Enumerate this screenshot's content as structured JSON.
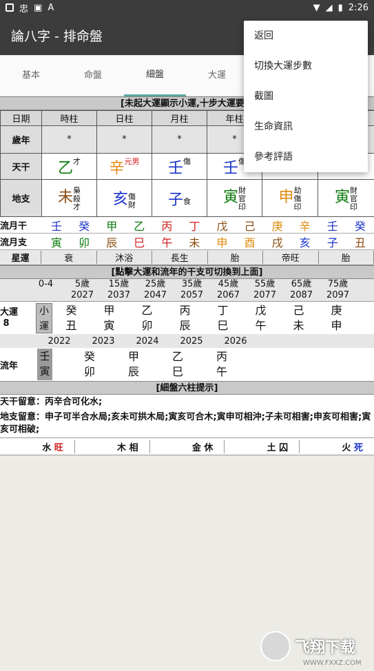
{
  "status": {
    "time": "2:26",
    "left_icons": [
      "square-icon",
      "app-icon",
      "image-icon",
      "a-icon"
    ]
  },
  "appbar": {
    "title": "論八字 - 排命盤"
  },
  "tabs": [
    {
      "label": "基本"
    },
    {
      "label": "命盤"
    },
    {
      "label": "細盤"
    },
    {
      "label": "大運"
    }
  ],
  "section1": {
    "title": "[未起大運顯示小運,十步大運要打"
  },
  "pillars": {
    "headers": [
      "日期",
      "時柱",
      "日柱",
      "月柱",
      "年柱"
    ],
    "sui_nian": {
      "label": "歲年",
      "values": [
        "*",
        "*",
        "*",
        "*"
      ]
    },
    "tiangan": {
      "label": "天干"
    },
    "dizhi": {
      "label": "地支"
    }
  },
  "tiangan": [
    {
      "char": "乙",
      "sup": "才"
    },
    {
      "char": "辛",
      "sup": "元男"
    },
    {
      "char": "壬",
      "sup": "傷"
    },
    {
      "char": "壬",
      "sup": "傷"
    }
  ],
  "dizhi": [
    {
      "char": "未",
      "notes": [
        "梟",
        "殺",
        "才"
      ]
    },
    {
      "char": "亥",
      "notes": [
        "傷",
        "財"
      ]
    },
    {
      "char": "子",
      "notes": [
        "食"
      ]
    },
    {
      "char": "寅",
      "notes": [
        "財",
        "官",
        "印"
      ]
    },
    {
      "char": "申",
      "notes": [
        "劫",
        "傷",
        "印"
      ]
    },
    {
      "char": "寅",
      "notes": [
        "財",
        "官",
        "印"
      ]
    }
  ],
  "liuyue": {
    "gan_label": "流月干",
    "zhi_label": "流月支",
    "gan": [
      "壬",
      "癸",
      "甲",
      "乙",
      "丙",
      "丁",
      "戊",
      "己",
      "庚",
      "辛",
      "壬",
      "癸"
    ],
    "zhi": [
      "寅",
      "卯",
      "辰",
      "巳",
      "午",
      "未",
      "申",
      "酉",
      "戌",
      "亥",
      "子",
      "丑"
    ]
  },
  "xingyun": {
    "label": "星運",
    "values": [
      "衰",
      "沐浴",
      "長生",
      "胎",
      "帝旺",
      "胎"
    ]
  },
  "section2": {
    "title": "[點擊大運和流年的干支可切換到上面]"
  },
  "dayun": {
    "ages": [
      "0-4",
      "5歲",
      "15歲",
      "25歲",
      "35歲",
      "45歲",
      "55歲",
      "65歲",
      "75歲"
    ],
    "years": [
      "",
      "2027",
      "2037",
      "2047",
      "2057",
      "2067",
      "2077",
      "2087",
      "2097"
    ],
    "label": "大運",
    "count": "8",
    "xiaoyun": [
      "小",
      "運"
    ],
    "cells": [
      [
        "癸",
        "丑"
      ],
      [
        "甲",
        "寅"
      ],
      [
        "乙",
        "卯"
      ],
      [
        "丙",
        "辰"
      ],
      [
        "丁",
        "巳"
      ],
      [
        "戊",
        "午"
      ],
      [
        "己",
        "未"
      ],
      [
        "庚",
        "申"
      ]
    ]
  },
  "liunian": {
    "label": "流年",
    "years": [
      "2022",
      "2023",
      "2024",
      "2025",
      "2026"
    ],
    "current": [
      "壬",
      "寅"
    ],
    "cells": [
      [
        "癸",
        "卯"
      ],
      [
        "甲",
        "辰"
      ],
      [
        "乙",
        "巳"
      ],
      [
        "丙",
        "午"
      ]
    ]
  },
  "section3": {
    "title": "[細盤六柱提示]"
  },
  "hints": {
    "tiangan": "天干留意：丙辛合可化水;",
    "dizhi": "地支留意：申子可半合水局;亥未可拱木局;寅亥可合木;寅申可相沖;子未可相害;申亥可相害;寅亥可相破;"
  },
  "wuxing": [
    {
      "el": "水",
      "state": "旺"
    },
    {
      "el": "木",
      "state": "相"
    },
    {
      "el": "金",
      "state": "休"
    },
    {
      "el": "土",
      "state": "囚"
    },
    {
      "el": "火",
      "state": "死"
    }
  ],
  "menu": [
    "返回",
    "切換大運步數",
    "截圖",
    "生命資訊",
    "參考評語"
  ],
  "watermark": {
    "text": "飞翔下载",
    "url": "WWW.FXXZ.COM"
  }
}
